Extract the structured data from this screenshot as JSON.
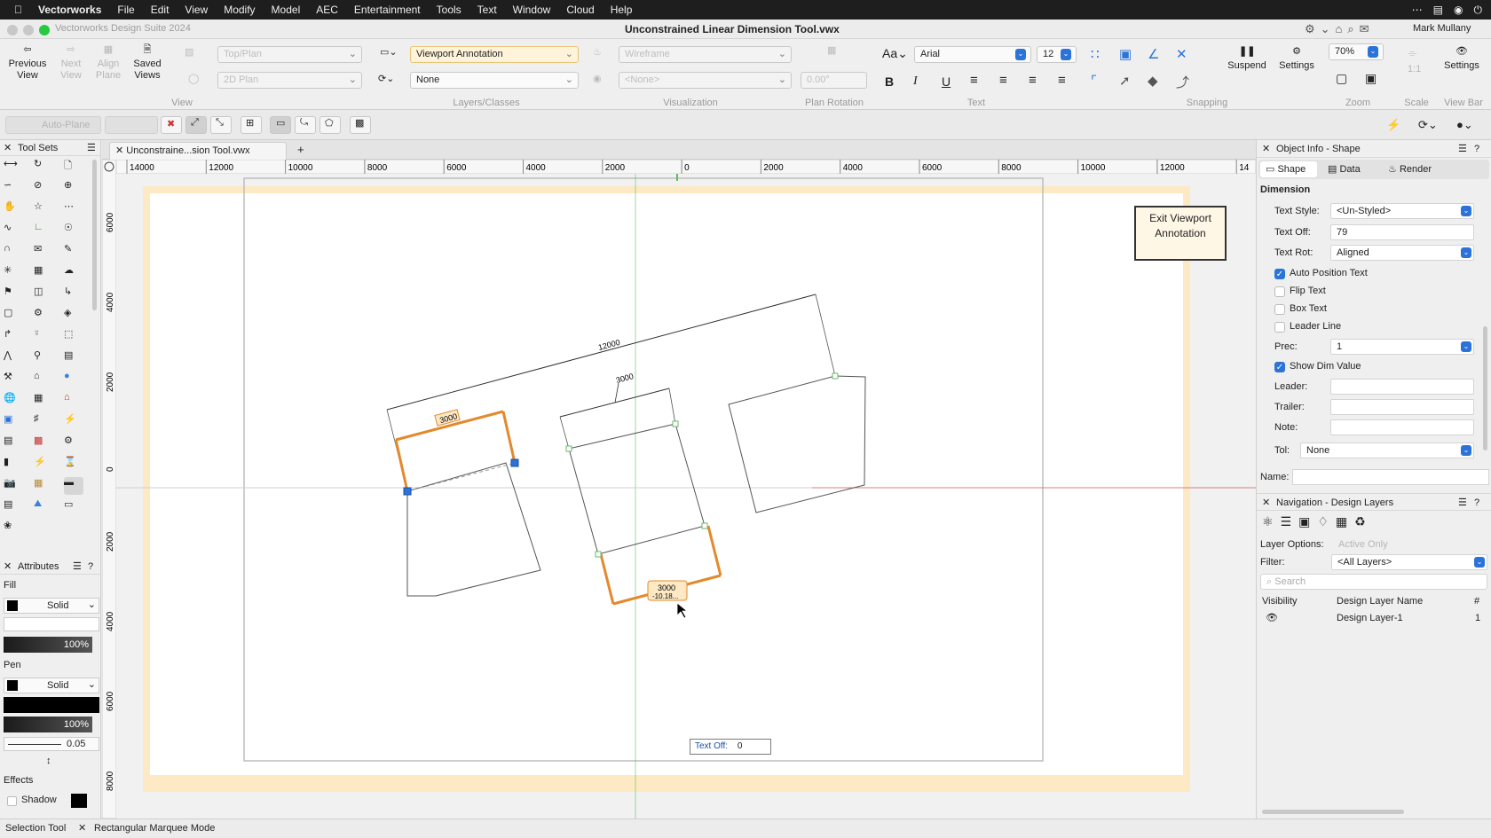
{
  "menubar": {
    "app": "Vectorworks",
    "items": [
      "File",
      "Edit",
      "View",
      "Modify",
      "Model",
      "AEC",
      "Entertainment",
      "Tools",
      "Text",
      "Window",
      "Cloud",
      "Help"
    ]
  },
  "titlebar": {
    "app_name": "Vectorworks Design Suite 2024",
    "doc_title": "Unconstrained Linear Dimension Tool.vwx",
    "user": "Mark Mullany"
  },
  "toolbar": {
    "previous_view": "Previous View",
    "next_view": "Next View",
    "align_plane": "Align Plane",
    "saved_views": "Saved Views",
    "view_select": "Top/Plan",
    "plan_select": "2D Plan",
    "layer_select": "Viewport Annotation",
    "class_select": "None",
    "render_select": "Wireframe",
    "vis_select": "<None>",
    "plan_rotation": "0.00°",
    "font_label": "Aa",
    "font_select": "Arial",
    "font_size": "12",
    "suspend": "Suspend",
    "settings": "Settings",
    "zoom_value": "70%",
    "scale_value": "1:1",
    "viewbar_settings": "Settings",
    "group_labels": {
      "view": "View",
      "layers": "Layers/Classes",
      "visualization": "Visualization",
      "plan_rotation": "Plan Rotation",
      "text": "Text",
      "snapping": "Snapping",
      "zoom": "Zoom",
      "scale": "Scale",
      "view_bar": "View Bar"
    },
    "text_style_buttons": [
      "B",
      "I",
      "U"
    ]
  },
  "modebar": {
    "auto_plane": "Auto-Plane"
  },
  "tool_sets": {
    "title": "Tool Sets"
  },
  "attributes": {
    "title": "Attributes",
    "fill_label": "Fill",
    "fill_style": "Solid",
    "fill_opacity": "100%",
    "pen_label": "Pen",
    "pen_style": "Solid",
    "pen_opacity": "100%",
    "line_weight": "0.05",
    "effects_label": "Effects",
    "shadow_label": "Shadow"
  },
  "document": {
    "tab_title": "Unconstraine...sion Tool.vwx",
    "ruler_h": [
      "14000",
      "12000",
      "10000",
      "8000",
      "6000",
      "4000",
      "2000",
      "0",
      "2000",
      "4000",
      "6000",
      "8000",
      "10000",
      "12000",
      "14"
    ],
    "ruler_v": [
      "6000",
      "4000",
      "2000",
      "0",
      "2000",
      "4000",
      "6000",
      "8000"
    ],
    "exit_viewport_annotation": "Exit Viewport Annotation",
    "dims": {
      "long": "12000",
      "mid": "3000",
      "left_orange": "3000",
      "bottom_orange": "3000",
      "bottom_orange_sub": "-10.18..."
    },
    "text_off_tip_label": "Text Off:",
    "text_off_tip_value": "0"
  },
  "object_info": {
    "title": "Object Info - Shape",
    "tabs": [
      "Shape",
      "Data",
      "Render"
    ],
    "section": "Dimension",
    "text_style_label": "Text Style:",
    "text_style_value": "<Un-Styled>",
    "text_off_label": "Text Off:",
    "text_off_value": "79",
    "text_rot_label": "Text Rot:",
    "text_rot_value": "Aligned",
    "auto_position": "Auto Position Text",
    "flip_text": "Flip Text",
    "box_text": "Box Text",
    "leader_line": "Leader Line",
    "prec_label": "Prec:",
    "prec_value": "1",
    "show_dim_value": "Show Dim Value",
    "leader_label": "Leader:",
    "trailer_label": "Trailer:",
    "note_label": "Note:",
    "tol_label": "Tol:",
    "tol_value": "None",
    "name_label": "Name:"
  },
  "navigation": {
    "title": "Navigation - Design Layers",
    "layer_options_label": "Layer Options:",
    "layer_options_value": "Active Only",
    "filter_label": "Filter:",
    "filter_value": "<All Layers>",
    "search_placeholder": "Search",
    "col_visibility": "Visibility",
    "col_name": "Design Layer Name",
    "col_num": "#",
    "layers": [
      {
        "name": "Design Layer-1",
        "num": "1"
      }
    ]
  },
  "statusbar": {
    "tool": "Selection Tool",
    "mode": "Rectangular Marquee Mode"
  },
  "colors": {
    "accent": "#2b73d9",
    "dim_highlight": "#e3892e",
    "annotation_bg": "#fde9c4",
    "guide_green": "#5bbf5b",
    "guide_red": "#e04848"
  }
}
